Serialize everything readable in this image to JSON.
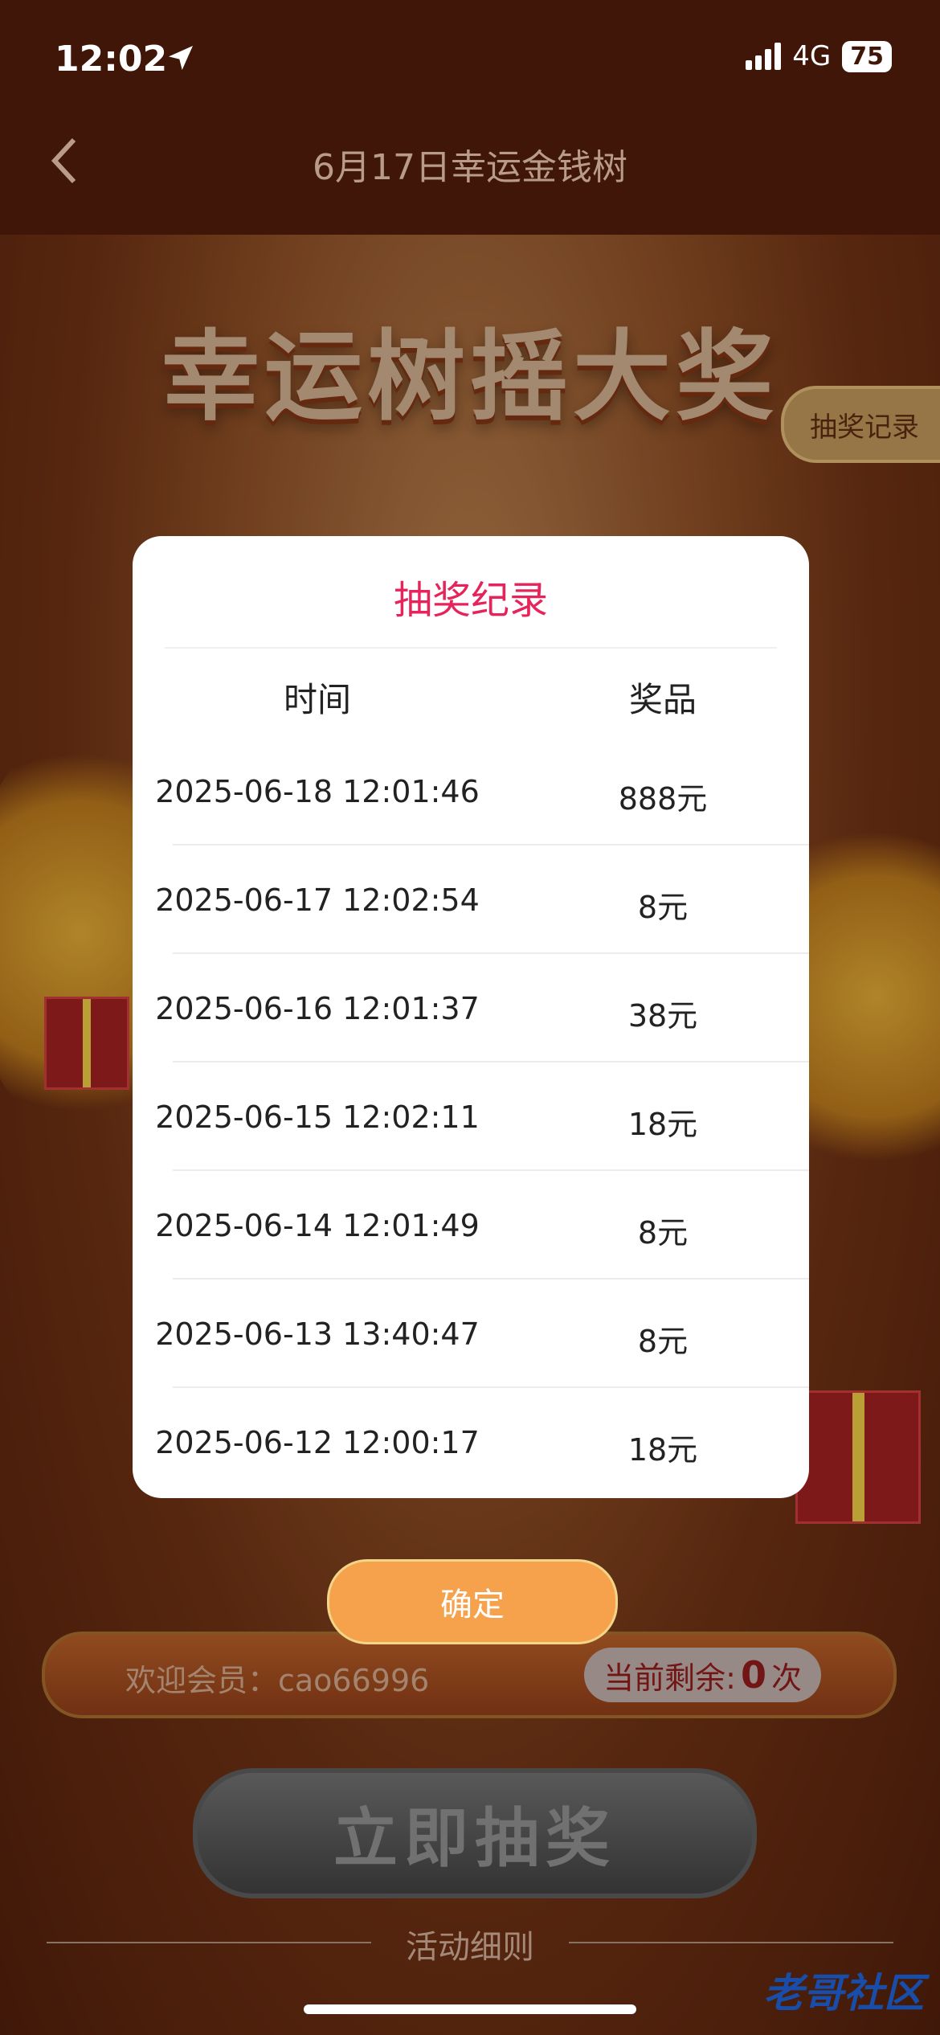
{
  "status": {
    "time": "12:02",
    "network": "4G",
    "battery": "75"
  },
  "nav": {
    "title": "6月17日幸运金钱树"
  },
  "banner": {
    "title": "幸运树摇大奖",
    "record_tab": "抽奖记录"
  },
  "modal": {
    "title": "抽奖纪录",
    "col_time": "时间",
    "col_prize": "奖品",
    "rows": [
      {
        "time": "2025-06-18 12:01:46",
        "prize": "888元"
      },
      {
        "time": "2025-06-17 12:02:54",
        "prize": "8元"
      },
      {
        "time": "2025-06-16 12:01:37",
        "prize": "38元"
      },
      {
        "time": "2025-06-15 12:02:11",
        "prize": "18元"
      },
      {
        "time": "2025-06-14 12:01:49",
        "prize": "8元"
      },
      {
        "time": "2025-06-13 13:40:47",
        "prize": "8元"
      },
      {
        "time": "2025-06-12 12:00:17",
        "prize": "18元"
      }
    ],
    "confirm": "确定"
  },
  "welcome": {
    "text": "欢迎会员：cao66996",
    "remain_label": "当前剩余:",
    "remain_count": "0",
    "remain_unit": "次"
  },
  "draw_button": "立即抽奖",
  "rules_title": "活动细则",
  "watermark": "老哥社区"
}
